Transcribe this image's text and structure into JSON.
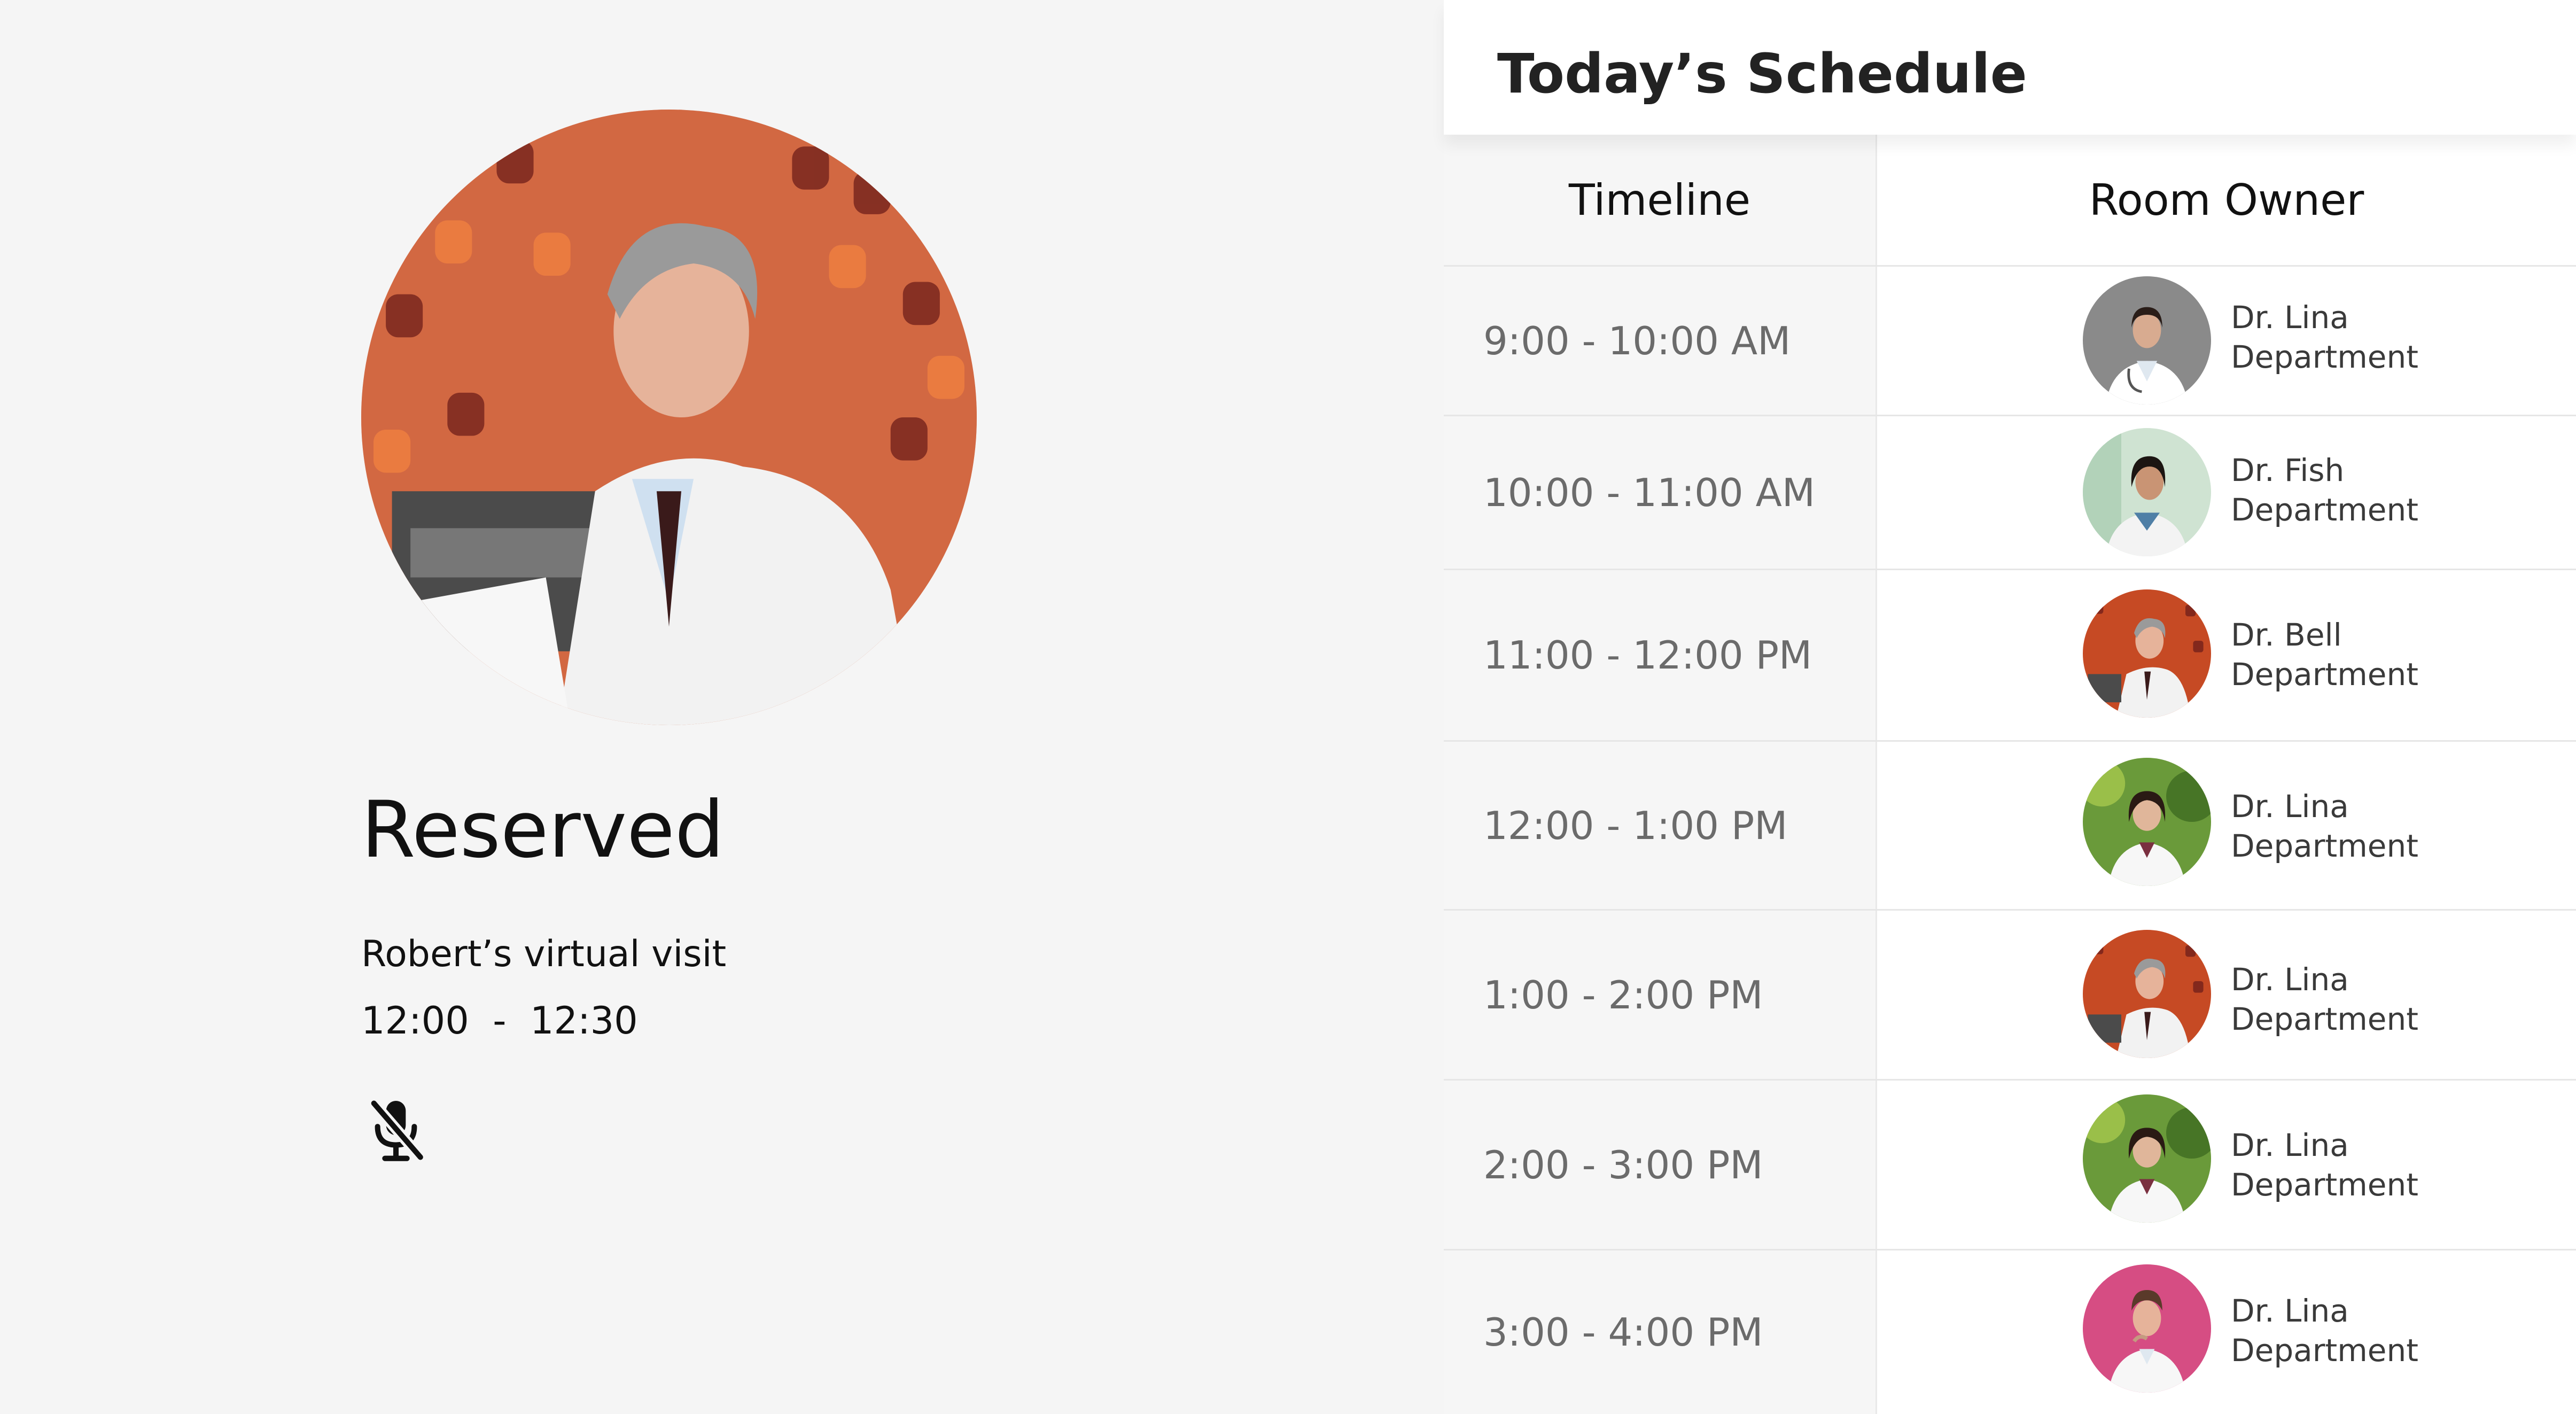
{
  "reservation": {
    "status": "Reserved",
    "visit_label": "Robert’s virtual visit",
    "time_range": "12:00  -  12:30",
    "mic_icon": "microphone-off-icon"
  },
  "schedule": {
    "title": "Today’s Schedule",
    "columns": [
      "Timeline",
      "Room Owner"
    ],
    "rows": [
      {
        "time": "9:00 - 10:00 AM",
        "owner": "Dr. Lina",
        "department": "Department",
        "avatar": "female-doctor-gray"
      },
      {
        "time": "10:00 - 11:00 AM",
        "owner": "Dr. Fish",
        "department": "Department",
        "avatar": "female-doctor-green"
      },
      {
        "time": "11:00 - 12:00 PM",
        "owner": "Dr. Bell",
        "department": "Department",
        "avatar": "male-doctor-red"
      },
      {
        "time": "12:00 - 1:00 PM",
        "owner": "Dr. Lina",
        "department": "Department",
        "avatar": "female-doctor-leaves"
      },
      {
        "time": "1:00 - 2:00 PM",
        "owner": "Dr. Lina",
        "department": "Department",
        "avatar": "male-doctor-red"
      },
      {
        "time": "2:00 - 3:00 PM",
        "owner": "Dr. Lina",
        "department": "Department",
        "avatar": "female-doctor-leaves"
      },
      {
        "time": "3:00 - 4:00 PM",
        "owner": "Dr. Lina",
        "department": "Department",
        "avatar": "male-doctor-pink"
      }
    ]
  }
}
